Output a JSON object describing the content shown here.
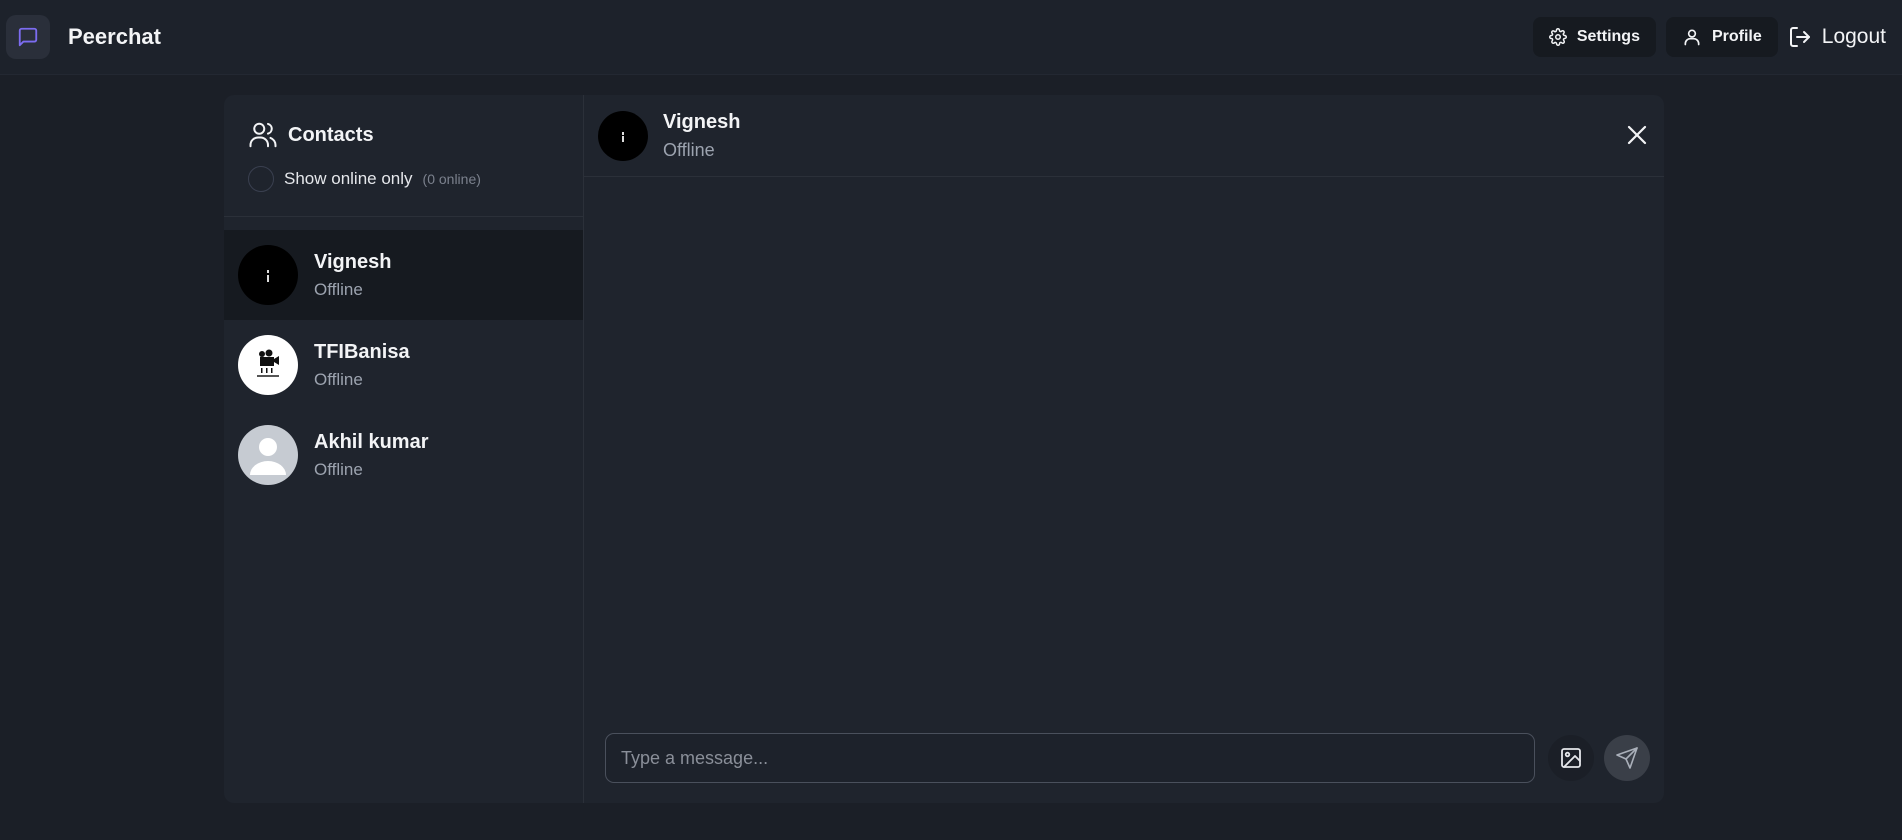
{
  "app": {
    "title": "Peerchat",
    "icons": {
      "brand": "message-square-icon"
    }
  },
  "nav": {
    "settings_label": "Settings",
    "profile_label": "Profile",
    "logout_label": "Logout"
  },
  "contacts": {
    "title": "Contacts",
    "filter_label": "Show online only",
    "online_count": "(0 online)",
    "items": [
      {
        "name": "Vignesh",
        "status": "Offline",
        "active": true
      },
      {
        "name": "TFIBanisa",
        "status": "Offline",
        "active": false
      },
      {
        "name": "Akhil kumar",
        "status": "Offline",
        "active": false
      }
    ]
  },
  "chat": {
    "name": "Vignesh",
    "status": "Offline",
    "input_placeholder": "Type a message...",
    "input_value": ""
  },
  "colors": {
    "accent": "#7c6cf0",
    "background": "#1b1f27",
    "panel": "#1f242d",
    "active_row": "#161a20"
  }
}
